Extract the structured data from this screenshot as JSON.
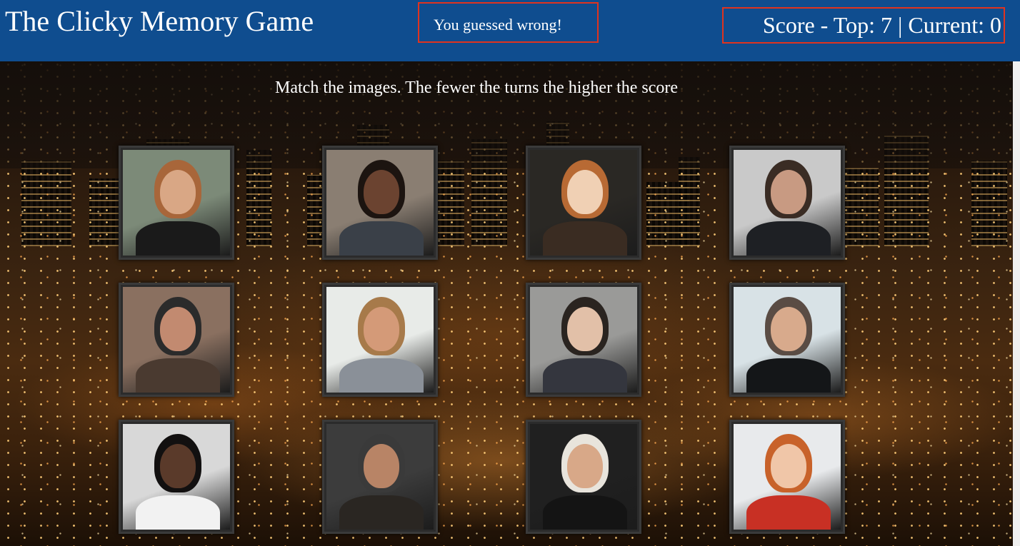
{
  "header": {
    "title": "The Clicky Memory Game",
    "message": "You guessed wrong!",
    "score": "Score - Top: 7 | Current: 0"
  },
  "instructions": "Match the images. The fewer the turns the higher the score",
  "colors": {
    "navbar": "#0f4d8f",
    "highlight_border": "#e0331f",
    "text": "#ffffff"
  },
  "cards": [
    {
      "name": "card-1",
      "bg": "#7c8a78",
      "skin": "#d9a785",
      "hair": "#a8663a",
      "body": "#1a1a1a"
    },
    {
      "name": "card-2",
      "bg": "#8a7e72",
      "skin": "#6b4330",
      "hair": "#1c1410",
      "body": "#3a4048"
    },
    {
      "name": "card-3",
      "bg": "#2a2824",
      "skin": "#f0d0b4",
      "hair": "#b86a34",
      "body": "#3a2c22"
    },
    {
      "name": "card-4",
      "bg": "#c9c9c9",
      "skin": "#c89a82",
      "hair": "#3a2c24",
      "body": "#1e2024"
    },
    {
      "name": "card-5",
      "bg": "#8a7060",
      "skin": "#c28a70",
      "hair": "#2b2b2b",
      "body": "#4a3a30"
    },
    {
      "name": "card-6",
      "bg": "#e8ebe8",
      "skin": "#d49a78",
      "hair": "#a77a4a",
      "body": "#8a9098"
    },
    {
      "name": "card-7",
      "bg": "#9a9a98",
      "skin": "#e2c0a8",
      "hair": "#2a2420",
      "body": "#34363e"
    },
    {
      "name": "card-8",
      "bg": "#d8e2e6",
      "skin": "#d8aa8c",
      "hair": "#5a4c44",
      "body": "#141618"
    },
    {
      "name": "card-9",
      "bg": "#d8d8d8",
      "skin": "#5a3a2a",
      "hair": "#121010",
      "body": "#f2f2f2"
    },
    {
      "name": "card-10",
      "bg": "#3c3c3c",
      "skin": "#b88466",
      "hair": "#3a3a3a",
      "body": "#2a2622"
    },
    {
      "name": "card-11",
      "bg": "#202020",
      "skin": "#d8a888",
      "hair": "#e8e4dc",
      "body": "#141414"
    },
    {
      "name": "card-12",
      "bg": "#e8eaec",
      "skin": "#f0c6a8",
      "hair": "#c8622a",
      "body": "#c83024"
    }
  ]
}
